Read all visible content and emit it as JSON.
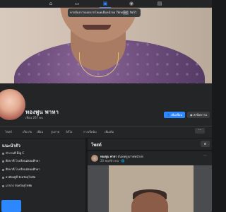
{
  "topbar": {
    "icons": [
      "home-icon",
      "watch-icon",
      "marketplace-icon",
      "groups-icon",
      "gaming-icon"
    ],
    "active": "marketplace-icon"
  },
  "toast": {
    "text": "หากต้องการออกจากโหมดเต็มหน้าจอ ให้กด",
    "key": "Esc",
    "close": "ปิดไว้"
  },
  "profile": {
    "name": "ทองพูน พาหา",
    "friends": "เพื่อน 267 คน",
    "add_friend_label": "เพิ่มเพื่อน",
    "message_label": "ส่งข้อความ"
  },
  "tabs": [
    "โพสต์",
    "เกี่ยวกับ",
    "เพื่อน",
    "รูปภาพ",
    "วิดีโอ",
    "การเช็คอิน",
    "เพิ่มเติม"
  ],
  "intro": {
    "title": "แนะนำตัว",
    "rows": [
      "ทำงานที่ Big C",
      "ศึกษาที่ โรงเรียนมัธยมศึกษา",
      "ศึกษาที่ โรงเรียนมัธยมศึกษา",
      "อาศัยอยู่ที่ จังหวัดสุโขทัย",
      "มาจาก จังหวัดสุโขทัย"
    ]
  },
  "posts": {
    "title": "โพสต์",
    "filter_label": "ตัวกรอง",
    "author": "ทองพูน พาหา",
    "action": "อัปเดตรูปภาพหน้าปก",
    "meta": "20 พฤศจิกายน · 🌐"
  },
  "colors": {
    "primary": "#2d88ff",
    "background": "#18191a",
    "surface": "#242526"
  }
}
